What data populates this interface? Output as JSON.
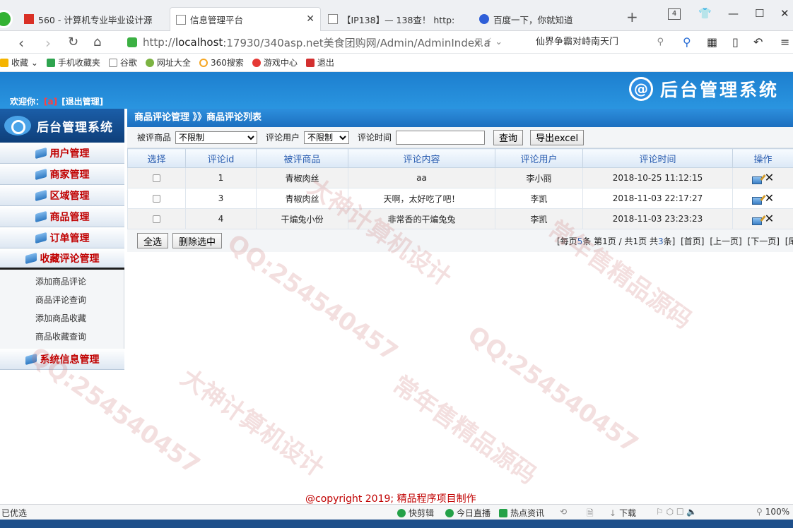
{
  "browser": {
    "tabs": [
      {
        "label": "560 - 计算机专业毕业设计源",
        "active": false
      },
      {
        "label": "信息管理平台",
        "active": true
      },
      {
        "label": "【IP138】— 138查！ http:",
        "active": false
      },
      {
        "label": "百度一下，你就知道",
        "active": false
      }
    ],
    "tab_count": "4",
    "url_prefix": "http://",
    "url_host": "localhost",
    "url_rest": ":17930/340asp.net美食团购网/Admin/AdminIndex.a",
    "search_text": "仙界争霸对峙南天门",
    "bookmarks": [
      "收藏",
      "手机收藏夹",
      "谷歌",
      "网址大全",
      "360搜索",
      "游戏中心",
      "退出"
    ]
  },
  "header": {
    "welcome_label": "欢迎你：",
    "username": "[a]",
    "logout_label": "[退出管理]",
    "brand_mark": "@",
    "brand_title": "后台管理系统"
  },
  "sidebar": {
    "title": "后台管理系统",
    "items": [
      {
        "label": "用户管理"
      },
      {
        "label": "商家管理"
      },
      {
        "label": "区域管理"
      },
      {
        "label": "商品管理"
      },
      {
        "label": "订单管理"
      },
      {
        "label": "收藏评论管理"
      }
    ],
    "submenu": [
      {
        "label": "添加商品评论"
      },
      {
        "label": "商品评论查询"
      },
      {
        "label": "添加商品收藏"
      },
      {
        "label": "商品收藏查询"
      }
    ],
    "last_item": {
      "label": "系统信息管理"
    }
  },
  "breadcrumb": "商品评论管理 》》商品评论列表",
  "filters": {
    "product_label": "被评商品",
    "product_value": "不限制",
    "user_label": "评论用户",
    "user_value": "不限制",
    "time_label": "评论时间",
    "time_value": "",
    "query_button": "查询",
    "export_button": "导出excel"
  },
  "table": {
    "columns": [
      "选择",
      "评论id",
      "被评商品",
      "评论内容",
      "评论用户",
      "评论时间",
      "操作"
    ],
    "rows": [
      {
        "id": "1",
        "product": "青椒肉丝",
        "content": "aa",
        "user": "李小丽",
        "time": "2018-10-25 11:12:15"
      },
      {
        "id": "3",
        "product": "青椒肉丝",
        "content": "天啊，太好吃了吧！",
        "user": "李凯",
        "time": "2018-11-03 22:17:27"
      },
      {
        "id": "4",
        "product": "干煸兔小份",
        "content": "非常香的干煸兔兔",
        "user": "李凯",
        "time": "2018-11-03 23:23:23"
      }
    ]
  },
  "actions": {
    "select_all": "全选",
    "delete_selected": "删除选中"
  },
  "pager": {
    "prefix": "[每页",
    "per_page": "5",
    "mid1": "条 第",
    "current": "1",
    "mid2": "页 / 共",
    "total_pages": "1",
    "mid3": "页 共",
    "total_items": "3",
    "suffix": "条]",
    "first": "[首页]",
    "prev": "[上一页]",
    "next": "[下一页]",
    "last": "[尾页]"
  },
  "copyright": "@copyright 2019; 精品程序项目制作",
  "statusbar": {
    "left": "已优选",
    "items": [
      "快剪辑",
      "今日直播",
      "热点资讯",
      "下载",
      "100%"
    ]
  },
  "watermarks": [
    "QQ:254540457",
    "大神计算机设计",
    "常年售精品源码"
  ],
  "colors": {
    "header_blue": "#1d7fcf",
    "menu_red": "#c00000",
    "column_header_text": "#2a5db0"
  }
}
